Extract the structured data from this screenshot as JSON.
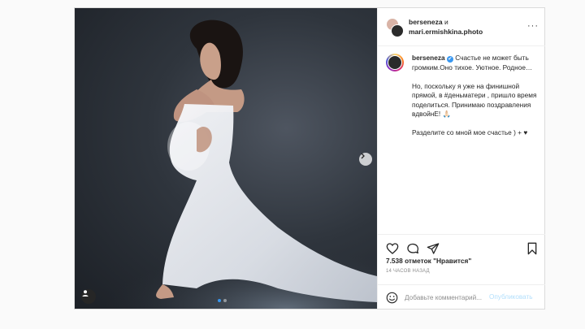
{
  "post": {
    "header": {
      "user1": "berseneza",
      "conjunction": "и",
      "user2": "mari.ermishkina.photo",
      "more_glyph": "···"
    },
    "caption": {
      "username": "berseneza",
      "verified_glyph": "✔",
      "paragraphs": [
        "Счастье не может быть громким.Оно тихое. Уютное. Родное…",
        "Но, поскольку я уже на финишной прямой, в #деньматери , пришло время поделиться. Принимаю поздравления вдвойнЕ! 🙏🏻",
        "Разделите со мной мое счастье ) + ♥"
      ]
    },
    "likes": "7.538 отметок \"Нравится\"",
    "time": "14 ЧАСОВ НАЗАД",
    "comment": {
      "placeholder": "Добавьте комментарий...",
      "publish": "Опубликовать"
    },
    "carousel": {
      "slides": 2,
      "active": 1
    },
    "colors": {
      "accent": "#3897f0",
      "publish_disabled": "#b2dffc",
      "text": "#262626",
      "muted": "#8e8e8e"
    },
    "icons": [
      "heart-icon",
      "comment-icon",
      "share-icon",
      "bookmark-icon",
      "emoji-icon",
      "tagged-user-icon",
      "chevron-right-icon",
      "more-options-icon"
    ]
  }
}
